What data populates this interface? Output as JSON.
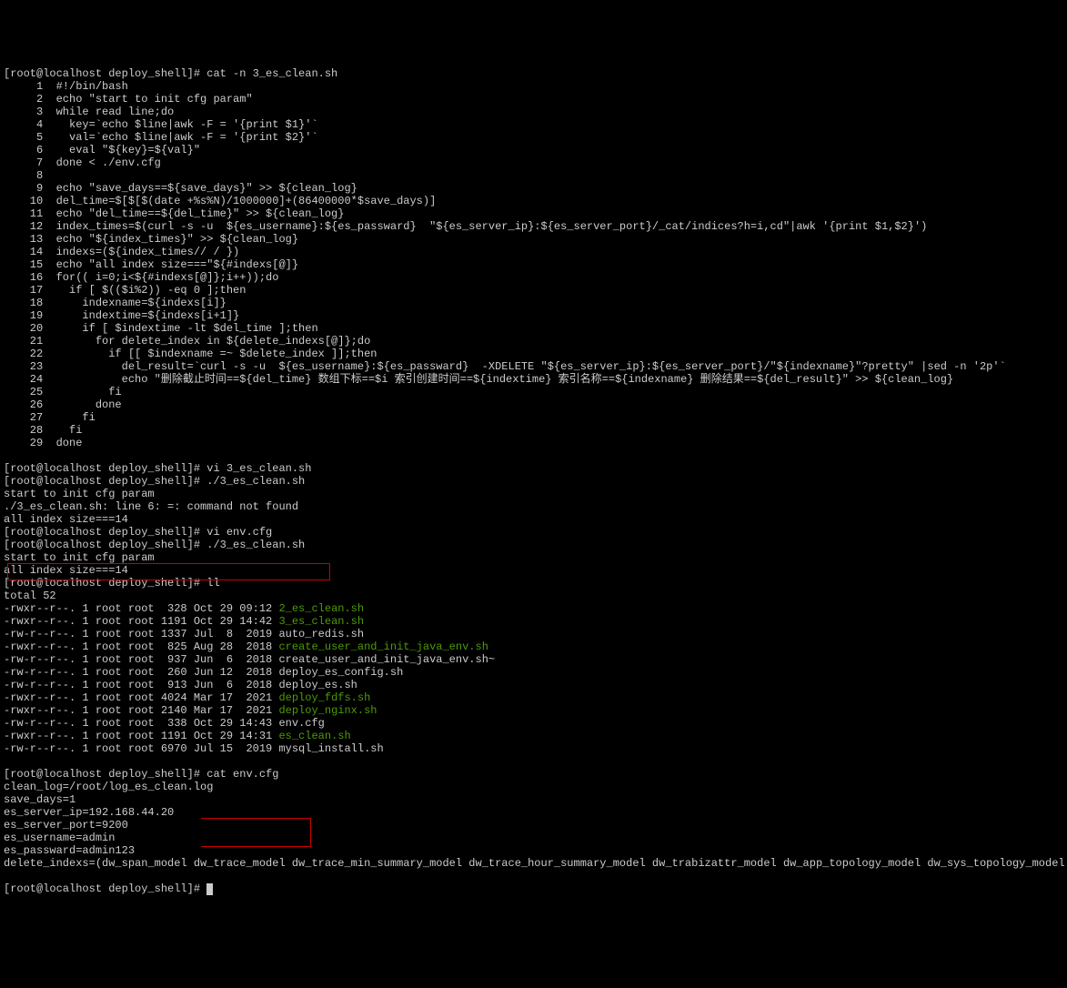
{
  "prompt1": "[root@localhost deploy_shell]# cat -n 3_es_clean.sh",
  "script_lines": [
    "     1  #!/bin/bash",
    "     2  echo \"start to init cfg param\"",
    "     3  while read line;do",
    "     4    key=`echo $line|awk -F = '{print $1}'`",
    "     5    val=`echo $line|awk -F = '{print $2}'`",
    "     6    eval \"${key}=${val}\"",
    "     7  done < ./env.cfg",
    "     8",
    "     9  echo \"save_days==${save_days}\" >> ${clean_log}",
    "    10  del_time=$[$[$(date +%s%N)/1000000]+(86400000*$save_days)]",
    "    11  echo \"del_time==${del_time}\" >> ${clean_log}",
    "    12  index_times=$(curl -s -u  ${es_username}:${es_passward}  \"${es_server_ip}:${es_server_port}/_cat/indices?h=i,cd\"|awk '{print $1,$2}')",
    "    13  echo \"${index_times}\" >> ${clean_log}",
    "    14  indexs=(${index_times// / })",
    "    15  echo \"all index size===\"${#indexs[@]}",
    "    16  for(( i=0;i<${#indexs[@]};i++));do",
    "    17    if [ $(($i%2)) -eq 0 ];then",
    "    18      indexname=${indexs[i]}",
    "    19      indextime=${indexs[i+1]}",
    "    20      if [ $indextime -lt $del_time ];then",
    "    21        for delete_index in ${delete_indexs[@]};do",
    "    22          if [[ $indexname =~ $delete_index ]];then",
    "    23            del_result=`curl -s -u  ${es_username}:${es_passward}  -XDELETE \"${es_server_ip}:${es_server_port}/\"${indexname}\"?pretty\" |sed -n '2p'`",
    "    24            echo \"删除截止时间==${del_time} 数组下标==$i 索引创建时间==${indextime} 索引名称==${indexname} 删除结果==${del_result}\" >> ${clean_log}",
    "    25          fi",
    "    26        done",
    "    27      fi",
    "    28    fi",
    "    29  done"
  ],
  "prompt2": "[root@localhost deploy_shell]# vi 3_es_clean.sh",
  "prompt3": "[root@localhost deploy_shell]# ./3_es_clean.sh",
  "out1": "start to init cfg param",
  "out2": "./3_es_clean.sh: line 6: =: command not found",
  "out3": "all index size===14",
  "prompt4": "[root@localhost deploy_shell]# vi env.cfg",
  "prompt5": "[root@localhost deploy_shell]# ./3_es_clean.sh",
  "out4": "start to init cfg param",
  "out5": "all index size===14",
  "prompt6": "[root@localhost deploy_shell]# ll",
  "ll_total": "total 52",
  "ll": [
    {
      "perm": "-rwxr--r--. 1 root root  328 Oct 29 09:12 ",
      "name": "2_es_clean.sh",
      "exec": true
    },
    {
      "perm": "-rwxr--r--. 1 root root 1191 Oct 29 14:42 ",
      "name": "3_es_clean.sh",
      "exec": true
    },
    {
      "perm": "-rw-r--r--. 1 root root 1337 Jul  8  2019 ",
      "name": "auto_redis.sh",
      "exec": false
    },
    {
      "perm": "-rwxr--r--. 1 root root  825 Aug 28  2018 ",
      "name": "create_user_and_init_java_env.sh",
      "exec": true
    },
    {
      "perm": "-rw-r--r--. 1 root root  937 Jun  6  2018 ",
      "name": "create_user_and_init_java_env.sh~",
      "exec": false
    },
    {
      "perm": "-rw-r--r--. 1 root root  260 Jun 12  2018 ",
      "name": "deploy_es_config.sh",
      "exec": false
    },
    {
      "perm": "-rw-r--r--. 1 root root  913 Jun  6  2018 ",
      "name": "deploy_es.sh",
      "exec": false
    },
    {
      "perm": "-rwxr--r--. 1 root root 4024 Mar 17  2021 ",
      "name": "deploy_fdfs.sh",
      "exec": true
    },
    {
      "perm": "-rwxr--r--. 1 root root 2140 Mar 17  2021 ",
      "name": "deploy_nginx.sh",
      "exec": true
    },
    {
      "perm": "-rw-r--r--. 1 root root  338 Oct 29 14:43 ",
      "name": "env.cfg",
      "exec": false
    },
    {
      "perm": "-rwxr--r--. 1 root root 1191 Oct 29 14:31 ",
      "name": "es_clean.sh",
      "exec": true
    },
    {
      "perm": "-rw-r--r--. 1 root root 6970 Jul 15  2019 ",
      "name": "mysql_install.sh",
      "exec": false
    }
  ],
  "prompt7": "[root@localhost deploy_shell]# cat env.cfg",
  "cfg": [
    "clean_log=/root/log_es_clean.log",
    "save_days=1",
    "es_server_ip=192.168.44.20",
    "es_server_port=9200",
    "es_username=admin",
    "es_passward=admin123",
    "delete_indexs=(dw_span_model dw_trace_model dw_trace_min_summary_model dw_trace_hour_summary_model dw_trabizattr_model dw_app_topology_model dw_sys_topology_model dw_tralog_model dw_traresource_model book_)"
  ],
  "prompt8": "[root@localhost deploy_shell]# "
}
